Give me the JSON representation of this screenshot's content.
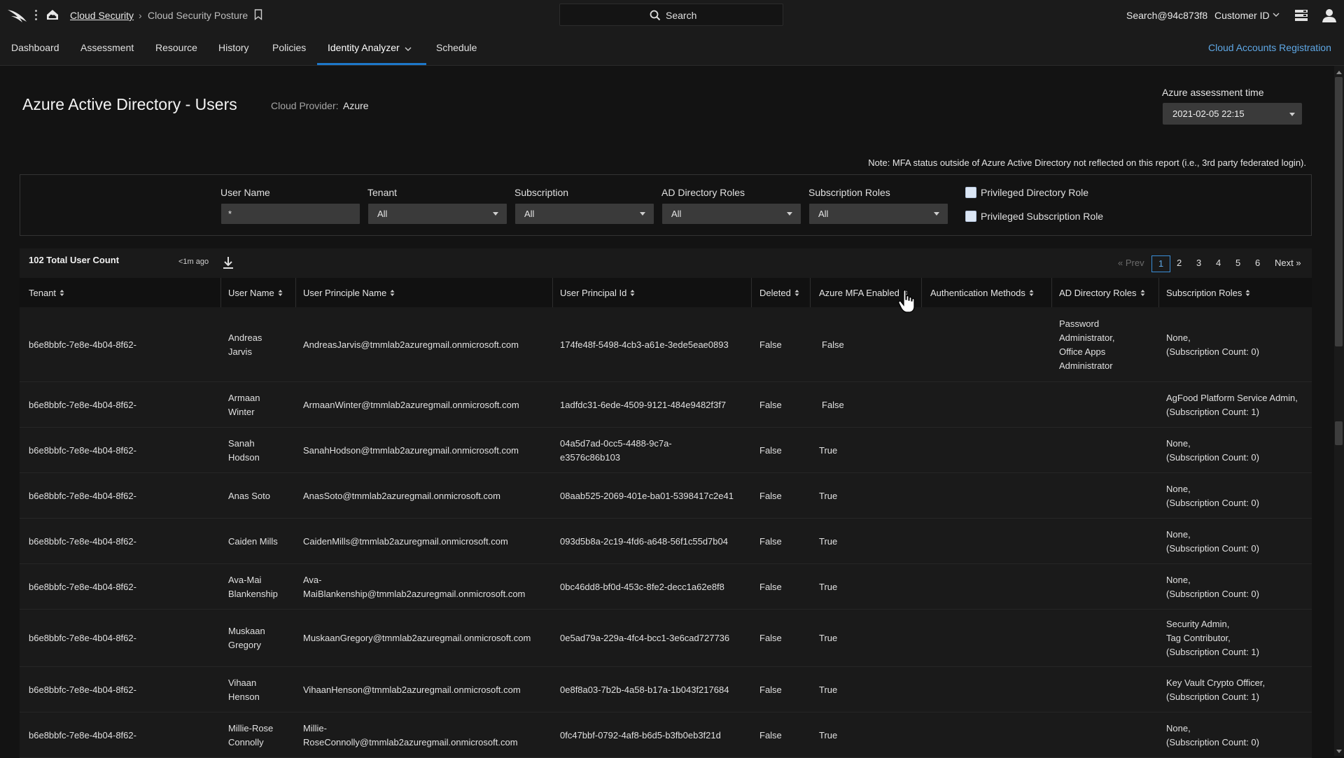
{
  "topbar": {
    "breadcrumb_link": "Cloud Security",
    "breadcrumb_sep": "›",
    "breadcrumb_current": "Cloud Security Posture",
    "search_label": "Search",
    "user": "Search@94c873f8",
    "customer": "Customer ID"
  },
  "nav": {
    "items": [
      "Dashboard",
      "Assessment",
      "Resource",
      "History",
      "Policies",
      "Identity Analyzer",
      "Schedule"
    ],
    "active": "Identity Analyzer",
    "right_link": "Cloud Accounts Registration"
  },
  "header": {
    "title": "Azure Active Directory - Users",
    "provider_label": "Cloud Provider:",
    "provider_value": "Azure",
    "assessment_label": "Azure assessment time",
    "assessment_value": "2021-02-05 22:15",
    "note": "Note: MFA status outside of Azure Active Directory not reflected on this report (i.e.,  3rd party federated login)."
  },
  "filters": {
    "user_name_label": "User Name",
    "user_name_value": "*",
    "tenant_label": "Tenant",
    "tenant_value": "All",
    "subscription_label": "Subscription",
    "subscription_value": "All",
    "ad_roles_label": "AD Directory Roles",
    "ad_roles_value": "All",
    "sub_roles_label": "Subscription Roles",
    "sub_roles_value": "All",
    "priv_dir_label": "Privileged Directory Role",
    "priv_sub_label": "Privileged Subscription Role"
  },
  "table_meta": {
    "count": "102 Total User Count",
    "updated": "<1m ago",
    "prev": "« Prev",
    "pages": [
      "1",
      "2",
      "3",
      "4",
      "5",
      "6"
    ],
    "current_page": "1",
    "next": "Next »"
  },
  "columns": [
    "Tenant",
    "User Name",
    "User Principle Name",
    "User Principal Id",
    "Deleted",
    "Azure MFA Enabled",
    "Authentication Methods",
    "AD Directory Roles",
    "Subscription Roles"
  ],
  "rows": [
    {
      "tenant": "b6e8bbfc-7e8e-4b04-8f62-",
      "name": [
        "Andreas",
        "Jarvis"
      ],
      "upn": [
        "AndreasJarvis@tmmlab2azuregmail.onmicrosoft.com"
      ],
      "id": [
        "174fe48f-5498-4cb3-a61e-3ede5eae0893"
      ],
      "deleted": "False",
      "mfa": "False",
      "auth": "",
      "ad": [
        "Password",
        "Administrator,",
        "Office Apps",
        "Administrator"
      ],
      "sub": [
        "None,",
        "(Subscription Count: 0)"
      ]
    },
    {
      "tenant": "b6e8bbfc-7e8e-4b04-8f62-",
      "name": [
        "Armaan",
        "Winter"
      ],
      "upn": [
        "ArmaanWinter@tmmlab2azuregmail.onmicrosoft.com"
      ],
      "id": [
        "1adfdc31-6ede-4509-9121-484e9482f3f7"
      ],
      "deleted": "False",
      "mfa": "False",
      "auth": "",
      "ad": [],
      "sub": [
        "AgFood Platform Service Admin,",
        "(Subscription Count: 1)"
      ]
    },
    {
      "tenant": "b6e8bbfc-7e8e-4b04-8f62-",
      "name": [
        "Sanah",
        "Hodson"
      ],
      "upn": [
        "SanahHodson@tmmlab2azuregmail.onmicrosoft.com"
      ],
      "id": [
        "04a5d7ad-0cc5-4488-9c7a-",
        "e3576c86b103"
      ],
      "deleted": "False",
      "mfa": "True",
      "auth": "",
      "ad": [],
      "sub": [
        "None,",
        "(Subscription Count: 0)"
      ]
    },
    {
      "tenant": "b6e8bbfc-7e8e-4b04-8f62-",
      "name": [
        "Anas Soto"
      ],
      "upn": [
        "AnasSoto@tmmlab2azuregmail.onmicrosoft.com"
      ],
      "id": [
        "08aab525-2069-401e-ba01-5398417c2e41"
      ],
      "deleted": "False",
      "mfa": "True",
      "auth": "",
      "ad": [],
      "sub": [
        "None,",
        "(Subscription Count: 0)"
      ]
    },
    {
      "tenant": "b6e8bbfc-7e8e-4b04-8f62-",
      "name": [
        "Caiden Mills"
      ],
      "upn": [
        "CaidenMills@tmmlab2azuregmail.onmicrosoft.com"
      ],
      "id": [
        "093d5b8a-2c19-4fd6-a648-56f1c55d7b04"
      ],
      "deleted": "False",
      "mfa": "True",
      "auth": "",
      "ad": [],
      "sub": [
        "None,",
        "(Subscription Count: 0)"
      ]
    },
    {
      "tenant": "b6e8bbfc-7e8e-4b04-8f62-",
      "name": [
        "Ava-Mai",
        "Blankenship"
      ],
      "upn": [
        "Ava-",
        "MaiBlankenship@tmmlab2azuregmail.onmicrosoft.com"
      ],
      "id": [
        "0bc46dd8-bf0d-453c-8fe2-decc1a62e8f8"
      ],
      "deleted": "False",
      "mfa": "True",
      "auth": "",
      "ad": [],
      "sub": [
        "None,",
        "(Subscription Count: 0)"
      ]
    },
    {
      "tenant": "b6e8bbfc-7e8e-4b04-8f62-",
      "name": [
        "Muskaan",
        "Gregory"
      ],
      "upn": [
        "MuskaanGregory@tmmlab2azuregmail.onmicrosoft.com"
      ],
      "id": [
        "0e5ad79a-229a-4fc4-bcc1-3e6cad727736"
      ],
      "deleted": "False",
      "mfa": "True",
      "auth": "",
      "ad": [],
      "sub": [
        "Security Admin,",
        "Tag Contributor,",
        "(Subscription Count: 1)"
      ]
    },
    {
      "tenant": "b6e8bbfc-7e8e-4b04-8f62-",
      "name": [
        "Vihaan",
        "Henson"
      ],
      "upn": [
        "VihaanHenson@tmmlab2azuregmail.onmicrosoft.com"
      ],
      "id": [
        "0e8f8a03-7b2b-4a58-b17a-1b043f217684"
      ],
      "deleted": "False",
      "mfa": "True",
      "auth": "",
      "ad": [],
      "sub": [
        "Key Vault Crypto Officer,",
        "(Subscription Count: 1)"
      ]
    },
    {
      "tenant": "b6e8bbfc-7e8e-4b04-8f62-",
      "name": [
        "Millie-Rose",
        "Connolly"
      ],
      "upn": [
        "Millie-",
        "RoseConnolly@tmmlab2azuregmail.onmicrosoft.com"
      ],
      "id": [
        "0fc47bbf-0792-4af8-b6d5-b3fb0eb3f21d"
      ],
      "deleted": "False",
      "mfa": "True",
      "auth": "",
      "ad": [],
      "sub": [
        "None,",
        "(Subscription Count: 0)"
      ]
    }
  ]
}
